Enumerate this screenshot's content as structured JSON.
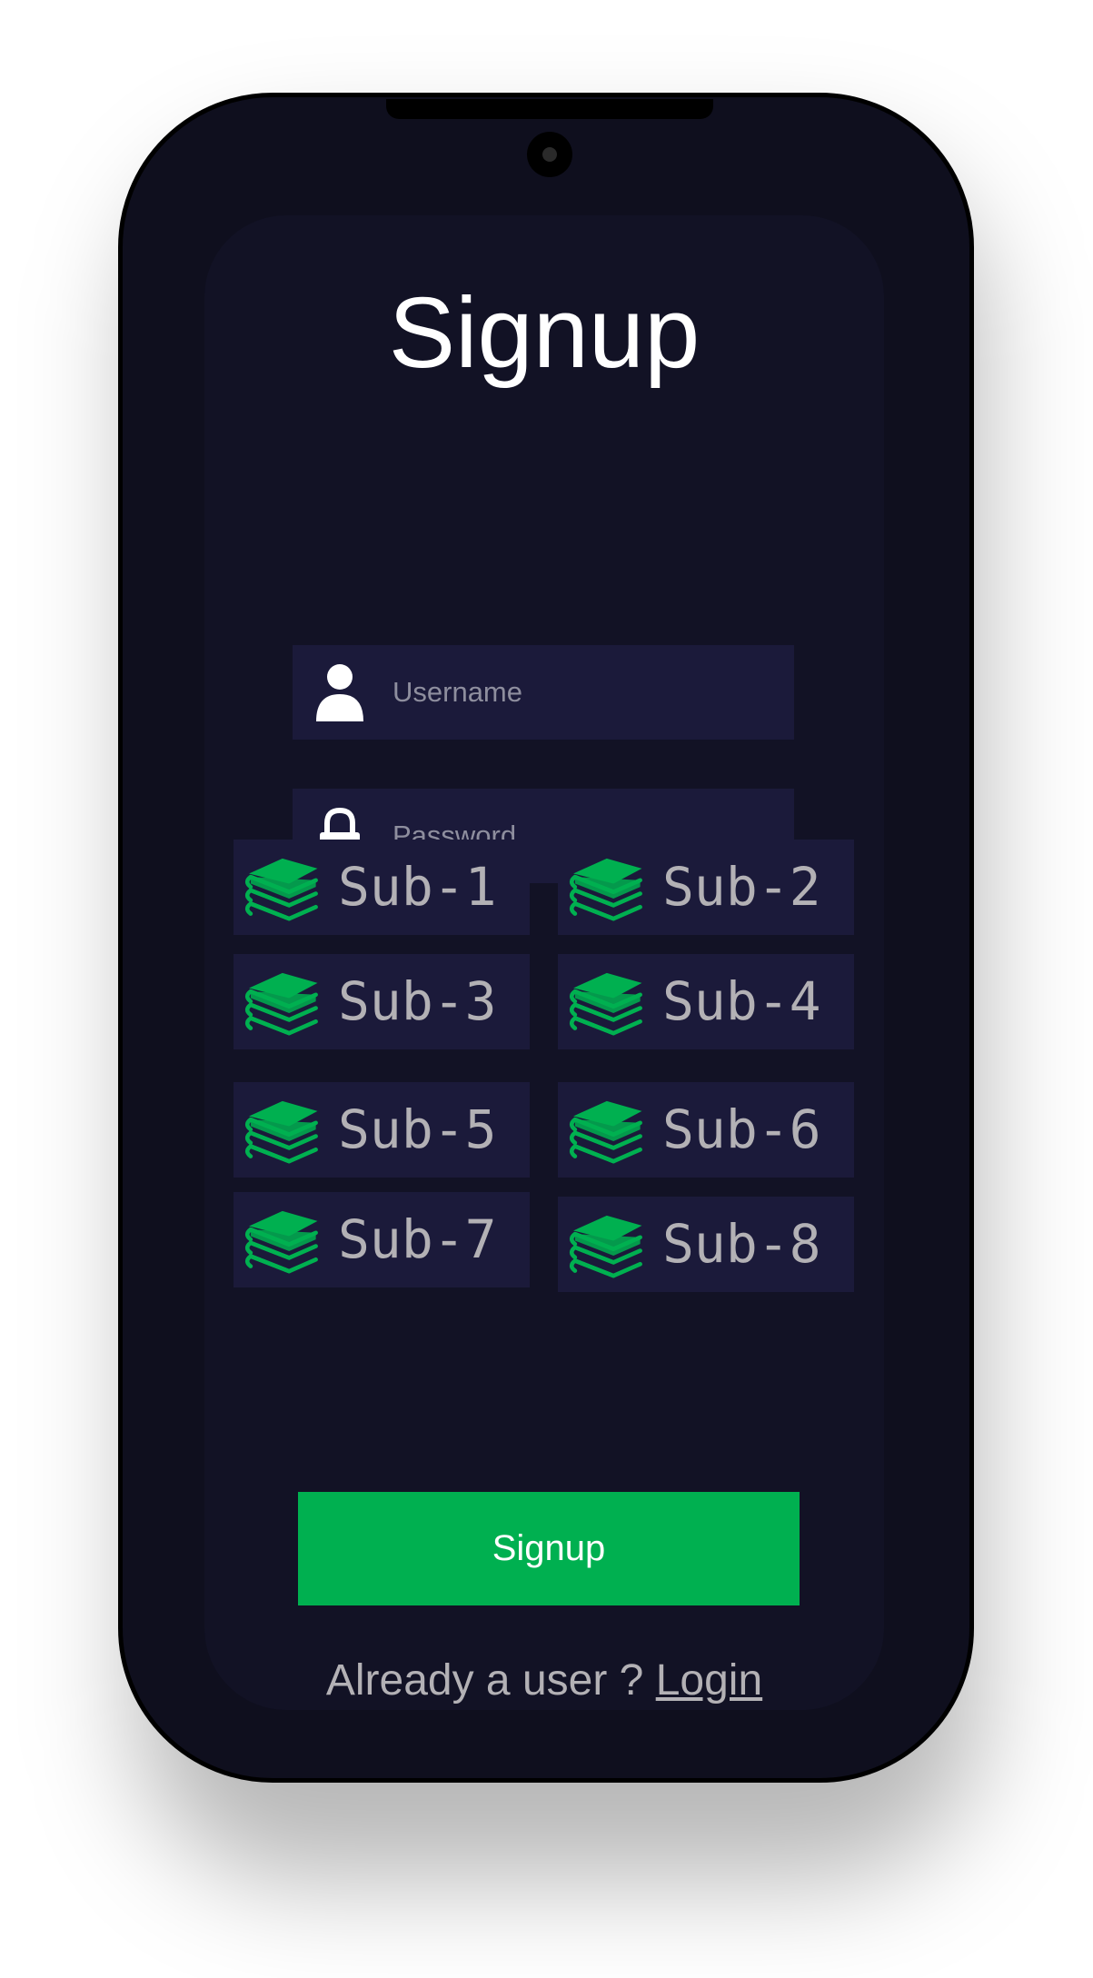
{
  "title": "Signup",
  "username": {
    "placeholder": "Username",
    "value": ""
  },
  "password": {
    "placeholder": "Password",
    "value": ""
  },
  "subjects": [
    "Sub-1",
    "Sub-2",
    "Sub-3",
    "Sub-4",
    "Sub-5",
    "Sub-6",
    "Sub-7",
    "Sub-8"
  ],
  "signup_button": "Signup",
  "footer": {
    "prompt": "Already a user ?",
    "login_link": "Login"
  },
  "colors": {
    "accent": "#00b050",
    "background": "#121225",
    "field": "#1b1a3a",
    "text_muted": "#b3b1b5"
  },
  "icons": {
    "username": "user-icon",
    "password": "lock-icon",
    "subject": "books-icon"
  }
}
